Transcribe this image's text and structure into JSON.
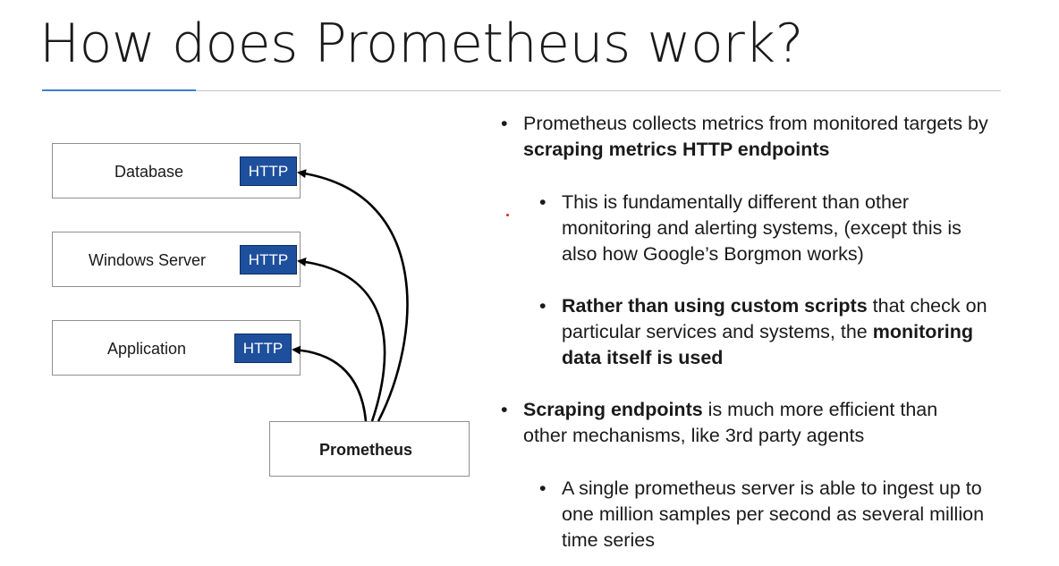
{
  "slide": {
    "title": "How does Prometheus work?"
  },
  "diagram": {
    "targets": [
      {
        "name": "Database",
        "endpoint": "HTTP"
      },
      {
        "name": "Windows Server",
        "endpoint": "HTTP"
      },
      {
        "name": "Application",
        "endpoint": "HTTP"
      }
    ],
    "server": "Prometheus"
  },
  "bullets": {
    "b1": {
      "pre": "Prometheus collects metrics from monitored targets by ",
      "bold": "scraping metrics HTTP endpoints"
    },
    "b1a": {
      "text": "This is fundamentally different than other monitoring and alerting systems, (except this is also how Google’s Borgmon works)"
    },
    "b1b": {
      "bold1": "Rather than using custom scripts",
      "mid": " that check on particular services and systems, the ",
      "bold2": "monitoring data itself is used"
    },
    "b2": {
      "bold": "Scraping endpoints",
      "post": " is much more efficient than other mechanisms, like 3rd party agents"
    },
    "b2a": {
      "text": "A single prometheus server is able to ingest up to one million samples per second as several million time series"
    }
  },
  "glyphs": {
    "bullet": "•"
  },
  "colors": {
    "http_fill": "#1d4f9c",
    "accent_rule": "#3f7fd1",
    "stray_dot": "#d7261e"
  }
}
